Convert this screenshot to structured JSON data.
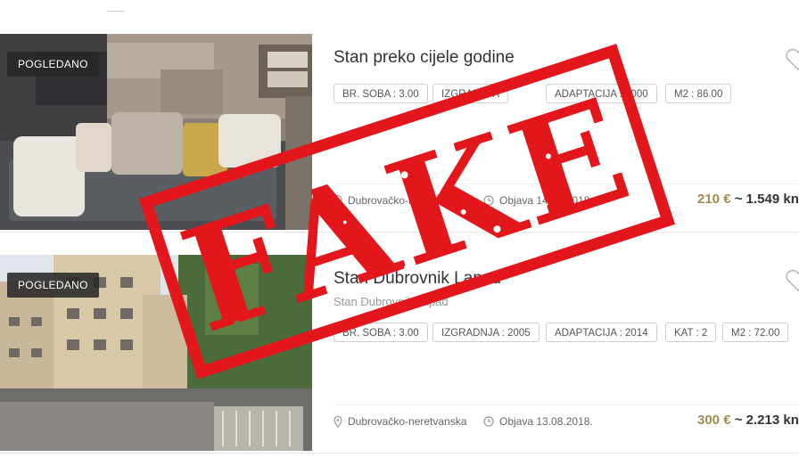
{
  "listings": [
    {
      "badge": "POGLEDANO",
      "title": "Stan preko cijele godine",
      "subtitle": "",
      "chips": [
        "BR. SOBA : 3.00",
        "IZGRADNJA",
        "ADAPTACIJA : 2000",
        "M2 : 86.00"
      ],
      "location": "Dubrovačko-neretvanska",
      "date": "Objava 14.08.2018.",
      "price_eur": "210 €",
      "price_kn": "~ 1.549 kn"
    },
    {
      "badge": "POGLEDANO",
      "title": "Stan Dubrovnik Lapad",
      "subtitle": "Stan Dubrovnik Lapad",
      "chips": [
        "BR. SOBA : 3.00",
        "IZGRADNJA : 2005",
        "ADAPTACIJA : 2014",
        "KAT : 2",
        "M2 : 72.00"
      ],
      "location": "Dubrovačko-neretvanska",
      "date": "Objava 13.08.2018.",
      "price_eur": "300 €",
      "price_kn": "~ 2.213 kn"
    }
  ],
  "stamp_text": "FAKE",
  "colors": {
    "stamp": "#e3161b",
    "price_accent": "#a08a4e"
  }
}
